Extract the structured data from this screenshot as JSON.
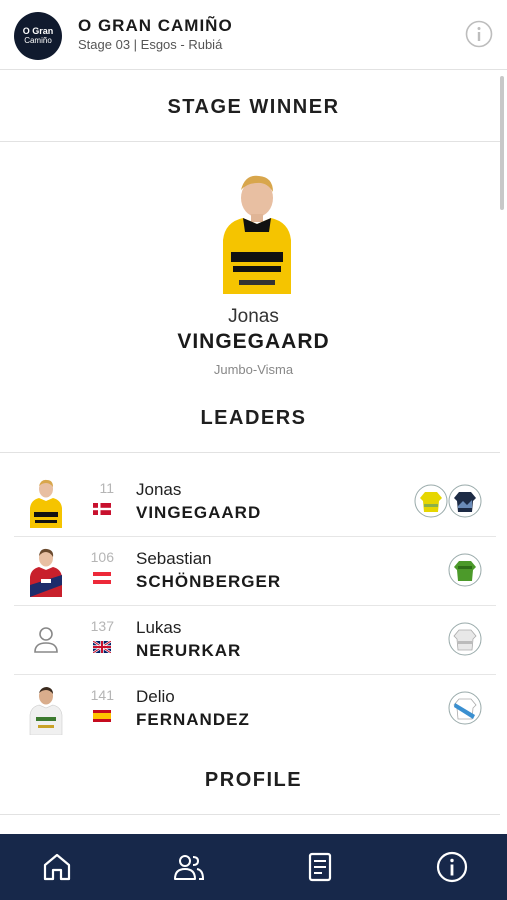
{
  "header": {
    "logo_text_line1": "O Gran",
    "logo_text_line2": "Camiño",
    "title": "O GRAN CAMIÑO",
    "subtitle": "Stage 03 | Esgos - Rubiá"
  },
  "sections": {
    "stage_winner": "STAGE WINNER",
    "leaders": "LEADERS",
    "profile": "PROFILE"
  },
  "winner": {
    "first_name": "Jonas",
    "last_name": "VINGEGAARD",
    "team": "Jumbo-Visma"
  },
  "leaders": [
    {
      "number": "11",
      "first": "Jonas",
      "last": "VINGEGAARD",
      "flag": "denmark",
      "jerseys": [
        "yellow-jersey-icon",
        "mountain-jersey-icon"
      ]
    },
    {
      "number": "106",
      "first": "Sebastian",
      "last": "SCHÖNBERGER",
      "flag": "austria",
      "jerseys": [
        "green-jersey-icon"
      ]
    },
    {
      "number": "137",
      "first": "Lukas",
      "last": "NERURKAR",
      "flag": "united-kingdom",
      "jerseys": [
        "white-jersey-icon"
      ]
    },
    {
      "number": "141",
      "first": "Delio",
      "last": "FERNANDEZ",
      "flag": "spain",
      "jerseys": [
        "blue-stripe-jersey-icon"
      ]
    }
  ],
  "tabbar": {
    "tabs": [
      "home-icon",
      "riders-icon",
      "document-icon",
      "info-icon"
    ]
  },
  "colors": {
    "tabbar_bg": "#17284a",
    "jumbo_yellow": "#f5c400"
  }
}
